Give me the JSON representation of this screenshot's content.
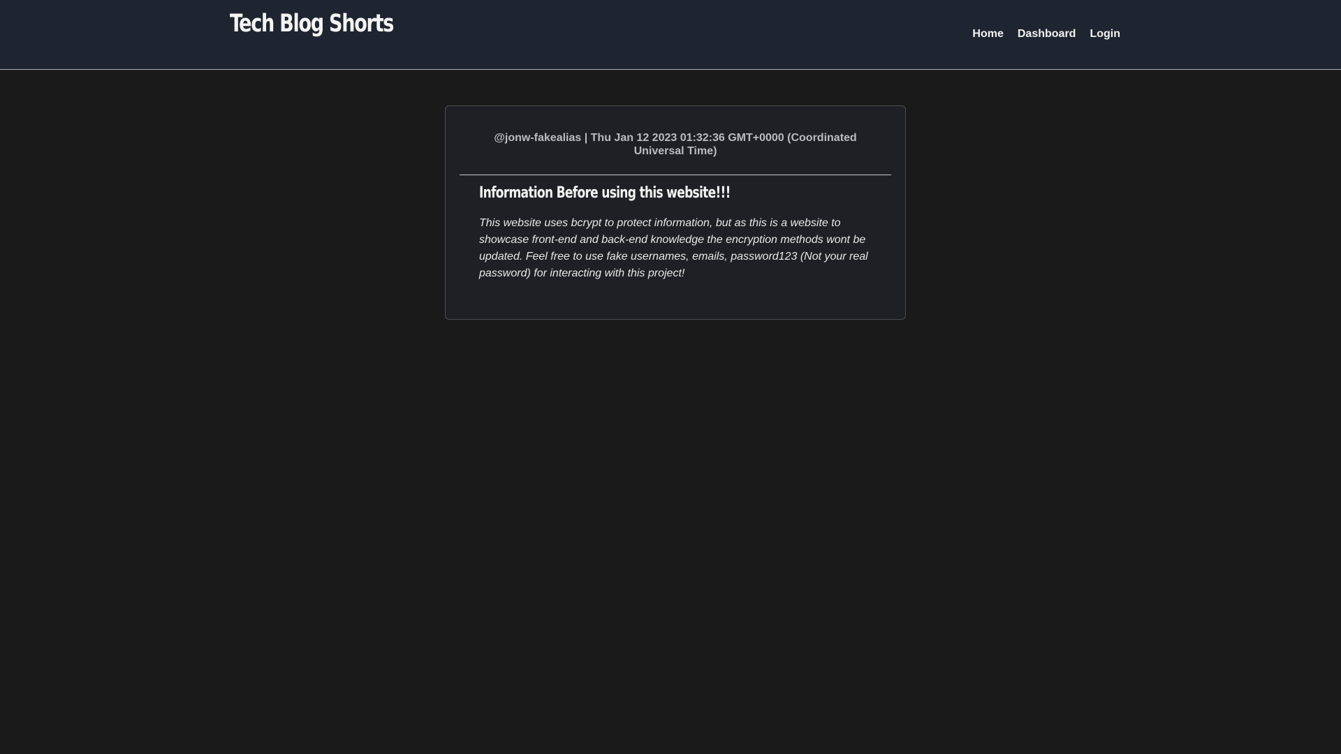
{
  "header": {
    "brand": "Tech Blog Shorts",
    "nav": [
      {
        "label": "Home"
      },
      {
        "label": "Dashboard"
      },
      {
        "label": "Login"
      }
    ]
  },
  "post": {
    "meta": "@jonw-fakealias | Thu Jan 12 2023 01:32:36 GMT+0000 (Coordinated Universal Time)",
    "title": "Information Before using this website!!!",
    "body": "This website uses bcrypt to protect information, but as this is a website to showcase front-end and back-end knowledge the encryption methods wont be updated. Feel free to use fake usernames, emails, password123 (Not your real password) for interacting with this project!"
  }
}
